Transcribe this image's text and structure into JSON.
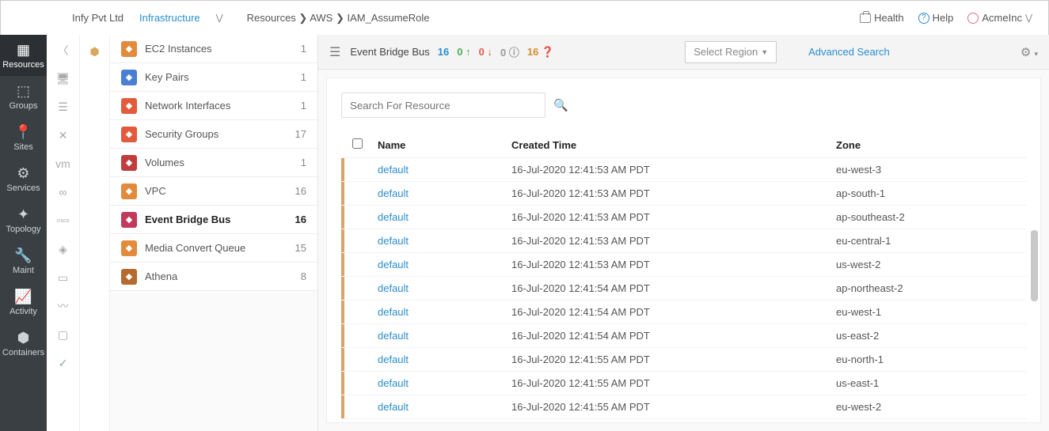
{
  "header": {
    "org": "Infy Pvt Ltd",
    "section": "Infrastructure",
    "breadcrumb": "Resources ❯ AWS ❯ IAM_AssumeRole",
    "health": "Health",
    "help": "Help",
    "account": "AcmeInc"
  },
  "leftRail": [
    {
      "label": "Resources",
      "icon": "▦"
    },
    {
      "label": "Groups",
      "icon": "⬚"
    },
    {
      "label": "Sites",
      "icon": "📍"
    },
    {
      "label": "Services",
      "icon": "⚙"
    },
    {
      "label": "Topology",
      "icon": "✦"
    },
    {
      "label": "Maint",
      "icon": "🔧"
    },
    {
      "label": "Activity",
      "icon": "📈"
    },
    {
      "label": "Containers",
      "icon": "⬢"
    }
  ],
  "resources": [
    {
      "name": "EC2 Instances",
      "count": "1",
      "color": "#e38b3d"
    },
    {
      "name": "Key Pairs",
      "count": "1",
      "color": "#4b7fd1"
    },
    {
      "name": "Network Interfaces",
      "count": "1",
      "color": "#e25b3d"
    },
    {
      "name": "Security Groups",
      "count": "17",
      "color": "#e25b3d"
    },
    {
      "name": "Volumes",
      "count": "1",
      "color": "#c03d3d"
    },
    {
      "name": "VPC",
      "count": "16",
      "color": "#e38b3d"
    },
    {
      "name": "Event Bridge Bus",
      "count": "16",
      "color": "#c1395b",
      "selected": true
    },
    {
      "name": "Media Convert Queue",
      "count": "15",
      "color": "#e38b3d"
    },
    {
      "name": "Athena",
      "count": "8",
      "color": "#b56b2f"
    }
  ],
  "toolbar": {
    "title": "Event Bridge Bus",
    "stats": {
      "total": "16",
      "up": "0",
      "down": "0",
      "unknown": "0",
      "warn": "16"
    },
    "region": "Select Region",
    "advanced": "Advanced Search"
  },
  "search": {
    "placeholder": "Search For Resource"
  },
  "table": {
    "headers": {
      "name": "Name",
      "time": "Created Time",
      "zone": "Zone"
    },
    "rows": [
      {
        "name": "default",
        "time": "16-Jul-2020 12:41:53 AM PDT",
        "zone": "eu-west-3"
      },
      {
        "name": "default",
        "time": "16-Jul-2020 12:41:53 AM PDT",
        "zone": "ap-south-1"
      },
      {
        "name": "default",
        "time": "16-Jul-2020 12:41:53 AM PDT",
        "zone": "ap-southeast-2"
      },
      {
        "name": "default",
        "time": "16-Jul-2020 12:41:53 AM PDT",
        "zone": "eu-central-1"
      },
      {
        "name": "default",
        "time": "16-Jul-2020 12:41:53 AM PDT",
        "zone": "us-west-2"
      },
      {
        "name": "default",
        "time": "16-Jul-2020 12:41:54 AM PDT",
        "zone": "ap-northeast-2"
      },
      {
        "name": "default",
        "time": "16-Jul-2020 12:41:54 AM PDT",
        "zone": "eu-west-1"
      },
      {
        "name": "default",
        "time": "16-Jul-2020 12:41:54 AM PDT",
        "zone": "us-east-2"
      },
      {
        "name": "default",
        "time": "16-Jul-2020 12:41:55 AM PDT",
        "zone": "eu-north-1"
      },
      {
        "name": "default",
        "time": "16-Jul-2020 12:41:55 AM PDT",
        "zone": "us-east-1"
      },
      {
        "name": "default",
        "time": "16-Jul-2020 12:41:55 AM PDT",
        "zone": "eu-west-2"
      }
    ]
  }
}
